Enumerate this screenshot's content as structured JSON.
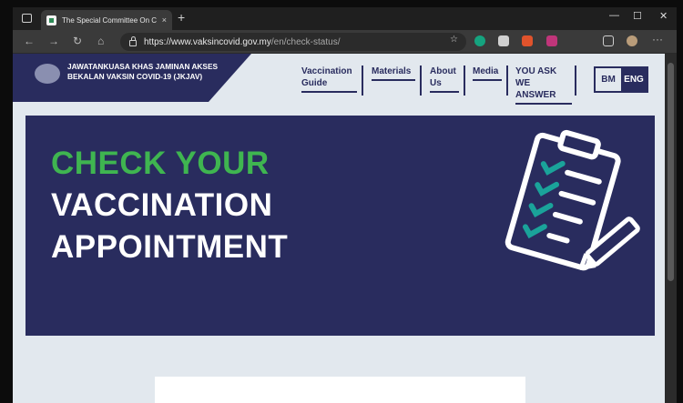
{
  "browser": {
    "tab_title": "The Special Committee On COVID",
    "tab_close": "×",
    "new_tab": "+",
    "url_host": "https://www.vaksincovid.gov.my",
    "url_path": "/en/check-status/",
    "window_controls": {
      "minimize": "—",
      "maximize": "☐",
      "close": "✕"
    },
    "nav": {
      "back": "←",
      "forward": "→",
      "reload": "↻",
      "home": "⌂"
    },
    "more": "···"
  },
  "site": {
    "brand": "JAWATANKUASA KHAS JAMINAN AKSES BEKALAN VAKSIN COVID-19 (JKJAV)",
    "menu": [
      {
        "label": "Vaccination Guide"
      },
      {
        "label": "Materials"
      },
      {
        "label": "About Us"
      },
      {
        "label": "Media"
      },
      {
        "label": "YOU ASK WE ANSWER"
      }
    ],
    "lang": {
      "bm": "BM",
      "eng": "ENG"
    },
    "hero": {
      "line1": "CHECK YOUR",
      "line2": "VACCINATION",
      "line3": "APPOINTMENT"
    }
  },
  "colors": {
    "navy": "#292c5e",
    "green": "#3fb550",
    "teal": "#1aa39a",
    "page_bg": "#e2e8ee"
  },
  "icons": [
    "sidebar-icon",
    "lock-icon",
    "favorite-icon",
    "grammarly-icon",
    "extension-icon",
    "clipboard-checklist-icon",
    "pencil-icon"
  ]
}
